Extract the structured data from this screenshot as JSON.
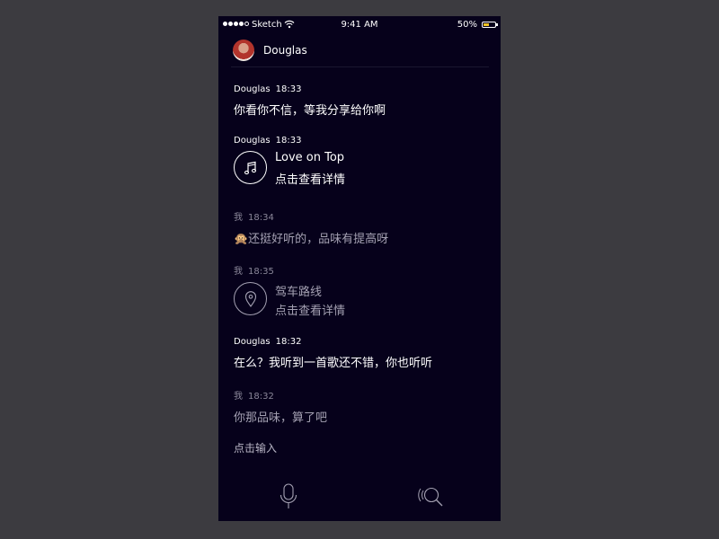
{
  "status_bar": {
    "carrier": "Sketch",
    "time": "9:41 AM",
    "battery": "50%"
  },
  "header": {
    "contact_name": "Douglas"
  },
  "messages": [
    {
      "sender": "Douglas",
      "time": "18:33",
      "text": "你看你不信，等我分享给你啊"
    },
    {
      "sender": "Douglas",
      "time": "18:33",
      "card_title": "Love on Top",
      "card_subtitle": "点击查看详情",
      "icon": "music-note-icon"
    },
    {
      "sender": "我",
      "time": "18:34",
      "text": "🙊还挺好听的，品味有提高呀"
    },
    {
      "sender": "我",
      "time": "18:35",
      "card_title": "驾车路线",
      "card_subtitle": "点击查看详情",
      "icon": "location-pin-icon"
    },
    {
      "sender": "Douglas",
      "time": "18:32",
      "text": "在么？我听到一首歌还不错，你也听听"
    },
    {
      "sender": "我",
      "time": "18:32",
      "text": "你那品味，算了吧"
    }
  ],
  "input": {
    "placeholder": "点击输入"
  },
  "bottom_bar": {
    "left_icon": "microphone-icon",
    "right_icon": "voice-search-icon"
  },
  "colors": {
    "background": "#3c3b40",
    "phone_background": "#06011b",
    "battery_fill": "#f3c623",
    "own_message_text": "#a4a1b2"
  }
}
